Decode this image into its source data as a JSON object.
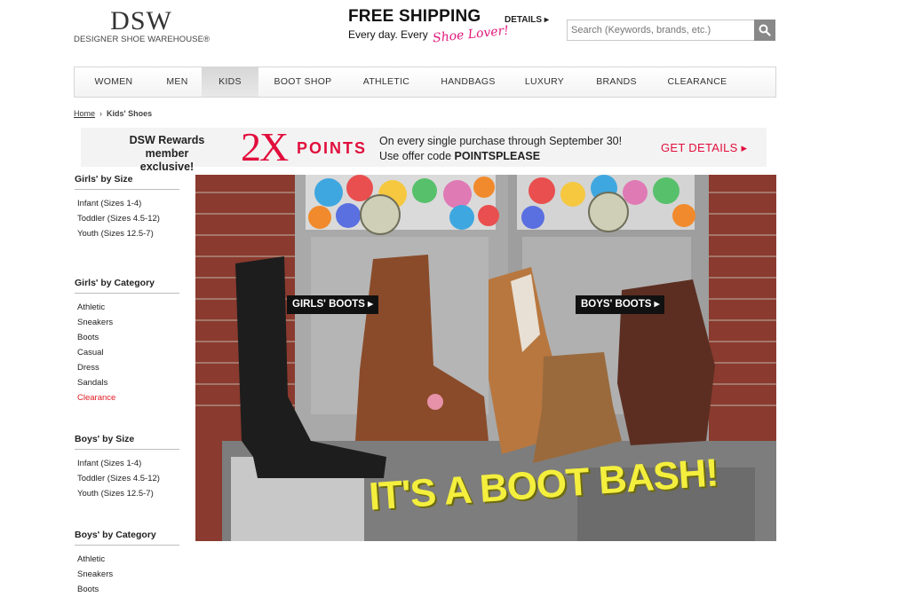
{
  "logo": {
    "main": "DSW",
    "sub": "DESIGNER SHOE WAREHOUSE®"
  },
  "shipping": {
    "title": "FREE SHIPPING",
    "line": "Every day. Every",
    "script": "Shoe Lover!",
    "details_label": "DETAILS ▸"
  },
  "search": {
    "placeholder": "Search (Keywords, brands, etc.)",
    "icon": "search-icon"
  },
  "nav": {
    "items": [
      {
        "label": "WOMEN"
      },
      {
        "label": "MEN"
      },
      {
        "label": "KIDS",
        "active": true
      },
      {
        "label": "BOOT SHOP"
      },
      {
        "label": "ATHLETIC"
      },
      {
        "label": "HANDBAGS"
      },
      {
        "label": "LUXURY"
      },
      {
        "label": "BRANDS"
      },
      {
        "label": "CLEARANCE"
      }
    ]
  },
  "breadcrumb": {
    "home": "Home",
    "separator": "›",
    "current": "Kids' Shoes"
  },
  "rewards": {
    "line1": "DSW Rewards",
    "line2": "member exclusive!",
    "multiplier": "2X",
    "points": "POINTS",
    "offer_line1": "On every single purchase through September 30!",
    "offer_prefix": "Use offer code ",
    "offer_code": "POINTSPLEASE",
    "cta": "GET DETAILS ▸",
    "accent_color": "#e10e3c"
  },
  "sidebar": {
    "sections": [
      {
        "title": "Girls' by Size",
        "items": [
          "Infant (Sizes 1-4)",
          "Toddler (Sizes 4.5-12)",
          "Youth (Sizes 12.5-7)"
        ]
      },
      {
        "title": "Girls' by Category",
        "items": [
          "Athletic",
          "Sneakers",
          "Boots",
          "Casual",
          "Dress",
          "Sandals",
          "Clearance"
        ]
      },
      {
        "title": "Boys' by Size",
        "items": [
          "Infant (Sizes 1-4)",
          "Toddler (Sizes 4.5-12)",
          "Youth (Sizes 12.5-7)"
        ]
      },
      {
        "title": "Boys' by Category",
        "items": [
          "Athletic",
          "Sneakers",
          "Boots"
        ]
      }
    ]
  },
  "hero": {
    "girls_button": "GIRLS' BOOTS ▸",
    "boys_button": "BOYS' BOOTS ▸",
    "headline": "IT'S A BOOT BASH!"
  }
}
